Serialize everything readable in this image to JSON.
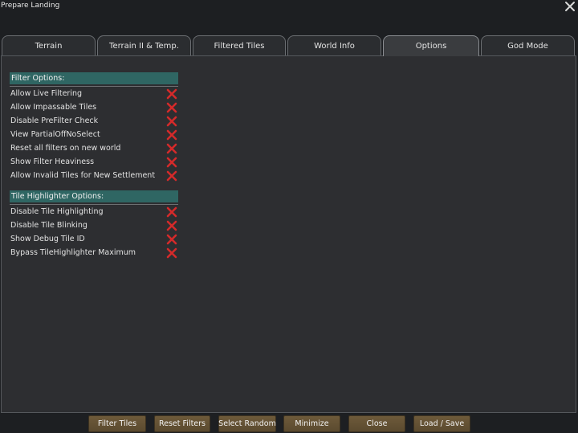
{
  "window": {
    "title": "Prepare Landing"
  },
  "tabs": [
    {
      "label": "Terrain"
    },
    {
      "label": "Terrain II & Temp."
    },
    {
      "label": "Filtered Tiles"
    },
    {
      "label": "World Info"
    },
    {
      "label": "Options",
      "active": true
    },
    {
      "label": "God Mode"
    }
  ],
  "filter_options": {
    "header": "Filter Options:",
    "items": [
      {
        "label": "Allow Live Filtering",
        "checked": false
      },
      {
        "label": "Allow Impassable Tiles",
        "checked": false
      },
      {
        "label": "Disable PreFilter Check",
        "checked": false
      },
      {
        "label": "View PartialOffNoSelect",
        "checked": false
      },
      {
        "label": "Reset all filters on new world",
        "checked": false
      },
      {
        "label": "Show Filter Heaviness",
        "checked": false
      },
      {
        "label": "Allow Invalid Tiles for New Settlement",
        "checked": false
      }
    ]
  },
  "tile_highlighter_options": {
    "header": "Tile Highlighter Options:",
    "items": [
      {
        "label": "Disable Tile Highlighting",
        "checked": false
      },
      {
        "label": "Disable Tile Blinking",
        "checked": false
      },
      {
        "label": "Show Debug Tile ID",
        "checked": false
      },
      {
        "label": "Bypass TileHighlighter Maximum",
        "checked": false
      }
    ]
  },
  "footer": {
    "filter_tiles": "Filter Tiles",
    "reset_filters": "Reset Filters",
    "select_random": "Select Random",
    "minimize": "Minimize",
    "close": "Close",
    "load_save": "Load / Save"
  },
  "icons": {
    "close": "close-icon",
    "unchecked": "red-x-icon"
  },
  "colors": {
    "section_header": "#2f6663",
    "uncheck_mark": "#d42a2a",
    "button": "#6e5a3a"
  }
}
